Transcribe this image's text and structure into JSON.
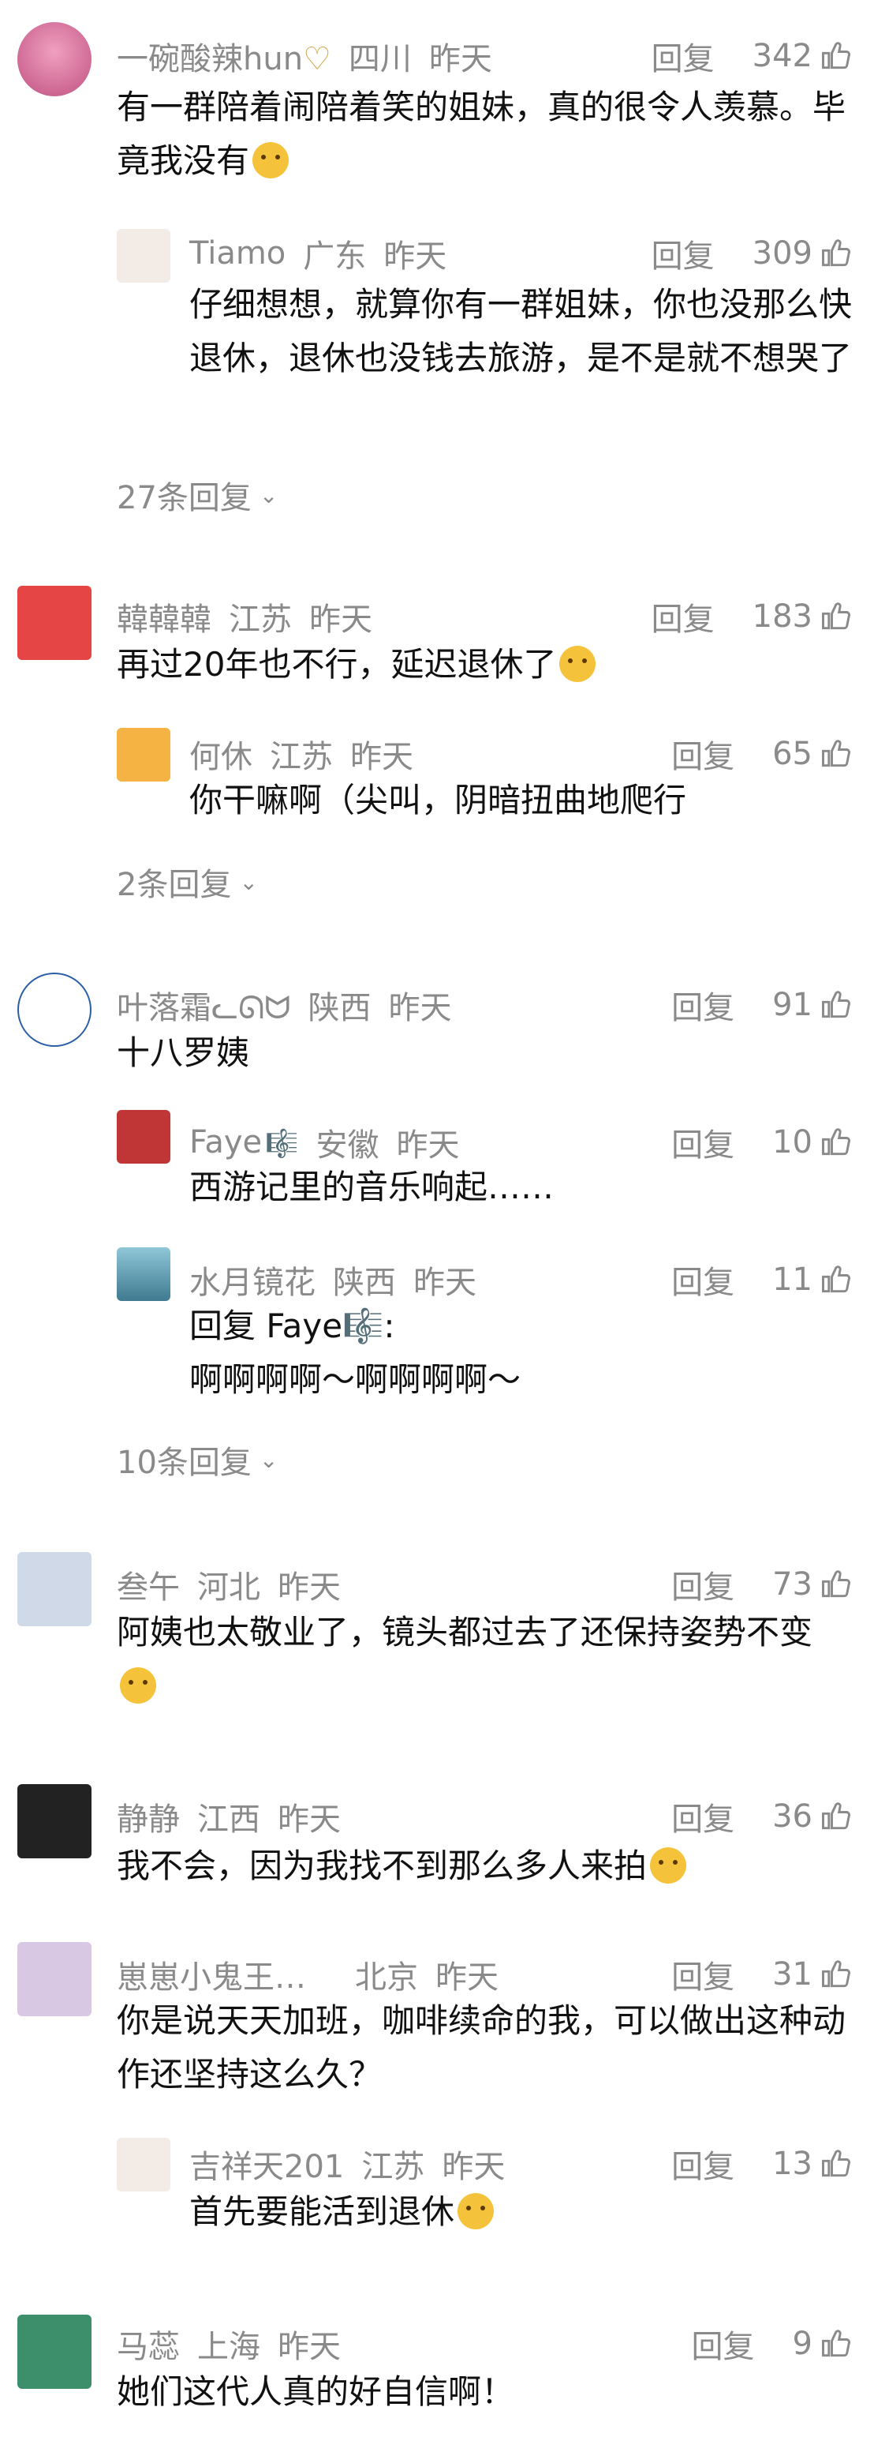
{
  "ui": {
    "reply_label": "回复"
  },
  "comments": [
    {
      "name": "一碗酸辣hun",
      "name_suffix": "♡",
      "location": "四川",
      "time": "昨天",
      "likes": "342",
      "text": "有一群陪着闹陪着笑的姐妹，真的很令人羡慕。毕竟我没有",
      "text_emoji": "crying-face",
      "replies": [
        {
          "name": "Tiamo",
          "location": "广东",
          "time": "昨天",
          "likes": "309",
          "text": "仔细想想，就算你有一群姐妹，你也没那么快退休，退休也没钱去旅游，是不是就不想哭了"
        }
      ],
      "more_replies": "27条回复"
    },
    {
      "name": "韓韓韓",
      "location": "江苏",
      "time": "昨天",
      "likes": "183",
      "text": "再过20年也不行，延迟退休了",
      "text_emoji": "sweat-laugh-face",
      "replies": [
        {
          "name": "何休",
          "location": "江苏",
          "time": "昨天",
          "likes": "65",
          "text": "你干嘛啊（尖叫，阴暗扭曲地爬行"
        }
      ],
      "more_replies": "2条回复"
    },
    {
      "name": "叶落霜ᓚᘏᗢ",
      "location": "陕西",
      "time": "昨天",
      "likes": "91",
      "text": "十八罗姨",
      "replies": [
        {
          "name": "Faye",
          "name_suffix": "🎼",
          "location": "安徽",
          "time": "昨天",
          "likes": "10",
          "text": "西游记里的音乐响起……"
        },
        {
          "name": "水月镜花",
          "location": "陕西",
          "time": "昨天",
          "likes": "11",
          "text_prefix": "回复 Faye🎼:",
          "text": "啊啊啊啊～啊啊啊啊～"
        }
      ],
      "more_replies": "10条回复"
    },
    {
      "name": "叁午",
      "location": "河北",
      "time": "昨天",
      "likes": "73",
      "text": "阿姨也太敬业了，镜头都过去了还保持姿势不变",
      "text_emoji": "thinking-face",
      "replies": []
    },
    {
      "name": "静静",
      "location": "江西",
      "time": "昨天",
      "likes": "36",
      "text": "我不会，因为我找不到那么多人来拍",
      "text_emoji": "sweat-laugh-face",
      "replies": []
    },
    {
      "name": "崽崽小鬼王…",
      "location": "北京",
      "time": "昨天",
      "likes": "31",
      "text": "你是说天天加班，咖啡续命的我，可以做出这种动作还坚持这么久？",
      "replies": [
        {
          "name": "吉祥天201",
          "location": "江苏",
          "time": "昨天",
          "likes": "13",
          "text": "首先要能活到退休",
          "text_emoji": "crying-face"
        }
      ]
    },
    {
      "name": "马蕊",
      "location": "上海",
      "time": "昨天",
      "likes": "9",
      "text": "她们这代人真的好自信啊！",
      "replies": []
    }
  ]
}
